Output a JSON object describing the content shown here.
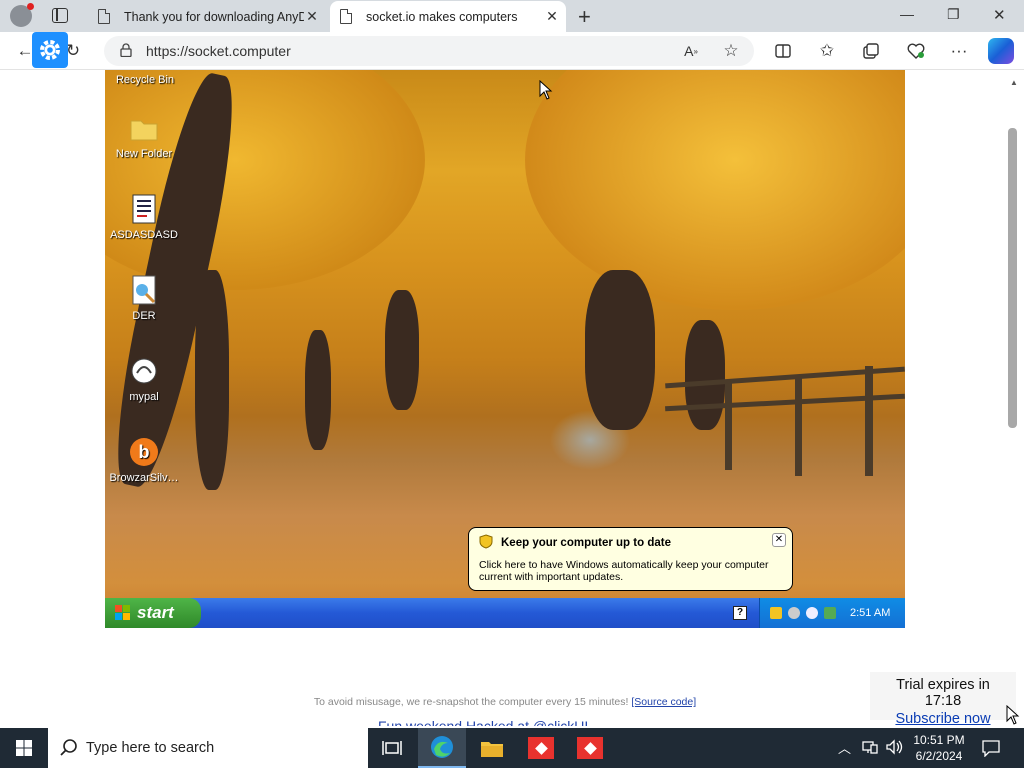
{
  "browser": {
    "tabs": [
      {
        "title": "Thank you for downloading AnyDesk",
        "active": false
      },
      {
        "title": "socket.io makes computers",
        "active": true
      }
    ],
    "new_tab_symbol": "+",
    "url": "https://socket.computer",
    "window_controls": {
      "minimize": "—",
      "restore": "❐",
      "close": "✕"
    },
    "toolbar_icons": [
      "read-aloud-icon",
      "favorite-star-icon",
      "split-screen-icon",
      "favorites-icon",
      "collections-icon",
      "browser-essentials-icon",
      "more-icon",
      "copilot-icon"
    ]
  },
  "remote_desktop": {
    "icons": [
      {
        "label": "Recycle Bin",
        "icon": "recycle-bin-icon"
      },
      {
        "label": "New Folder",
        "icon": "folder-icon"
      },
      {
        "label": "ASDASDASD",
        "icon": "document-icon"
      },
      {
        "label": "DER",
        "icon": "paint-file-icon"
      },
      {
        "label": "mypal",
        "icon": "mypal-icon"
      },
      {
        "label": "BrowzarSilv…",
        "icon": "browzar-icon"
      }
    ],
    "start_label": "start",
    "balloon": {
      "title": "Keep your computer up to date",
      "body": "Click here to have Windows automatically keep your computer current with important updates."
    },
    "clock": "2:51 AM"
  },
  "page": {
    "footer_note": "To avoid misusage, we re-snapshot the computer every 15 minutes!",
    "source_link": "[Source code]",
    "next_link": "Fun weekend Hacked at @clickUI",
    "trial_text": "Trial expires in 17:18",
    "subscribe_label": "Subscribe now"
  },
  "taskbar": {
    "search_placeholder": "Type here to search",
    "time": "10:51 PM",
    "date": "6/2/2024",
    "apps": [
      "task-view-icon",
      "edge-icon",
      "file-explorer-icon",
      "anydesk-icon",
      "anydesk-icon"
    ]
  },
  "colors": {
    "accent": "#0a3cb4",
    "xp_taskbar": "#2459d6",
    "xp_start": "#3c9a35",
    "win_taskbar": "#1f2a35"
  }
}
